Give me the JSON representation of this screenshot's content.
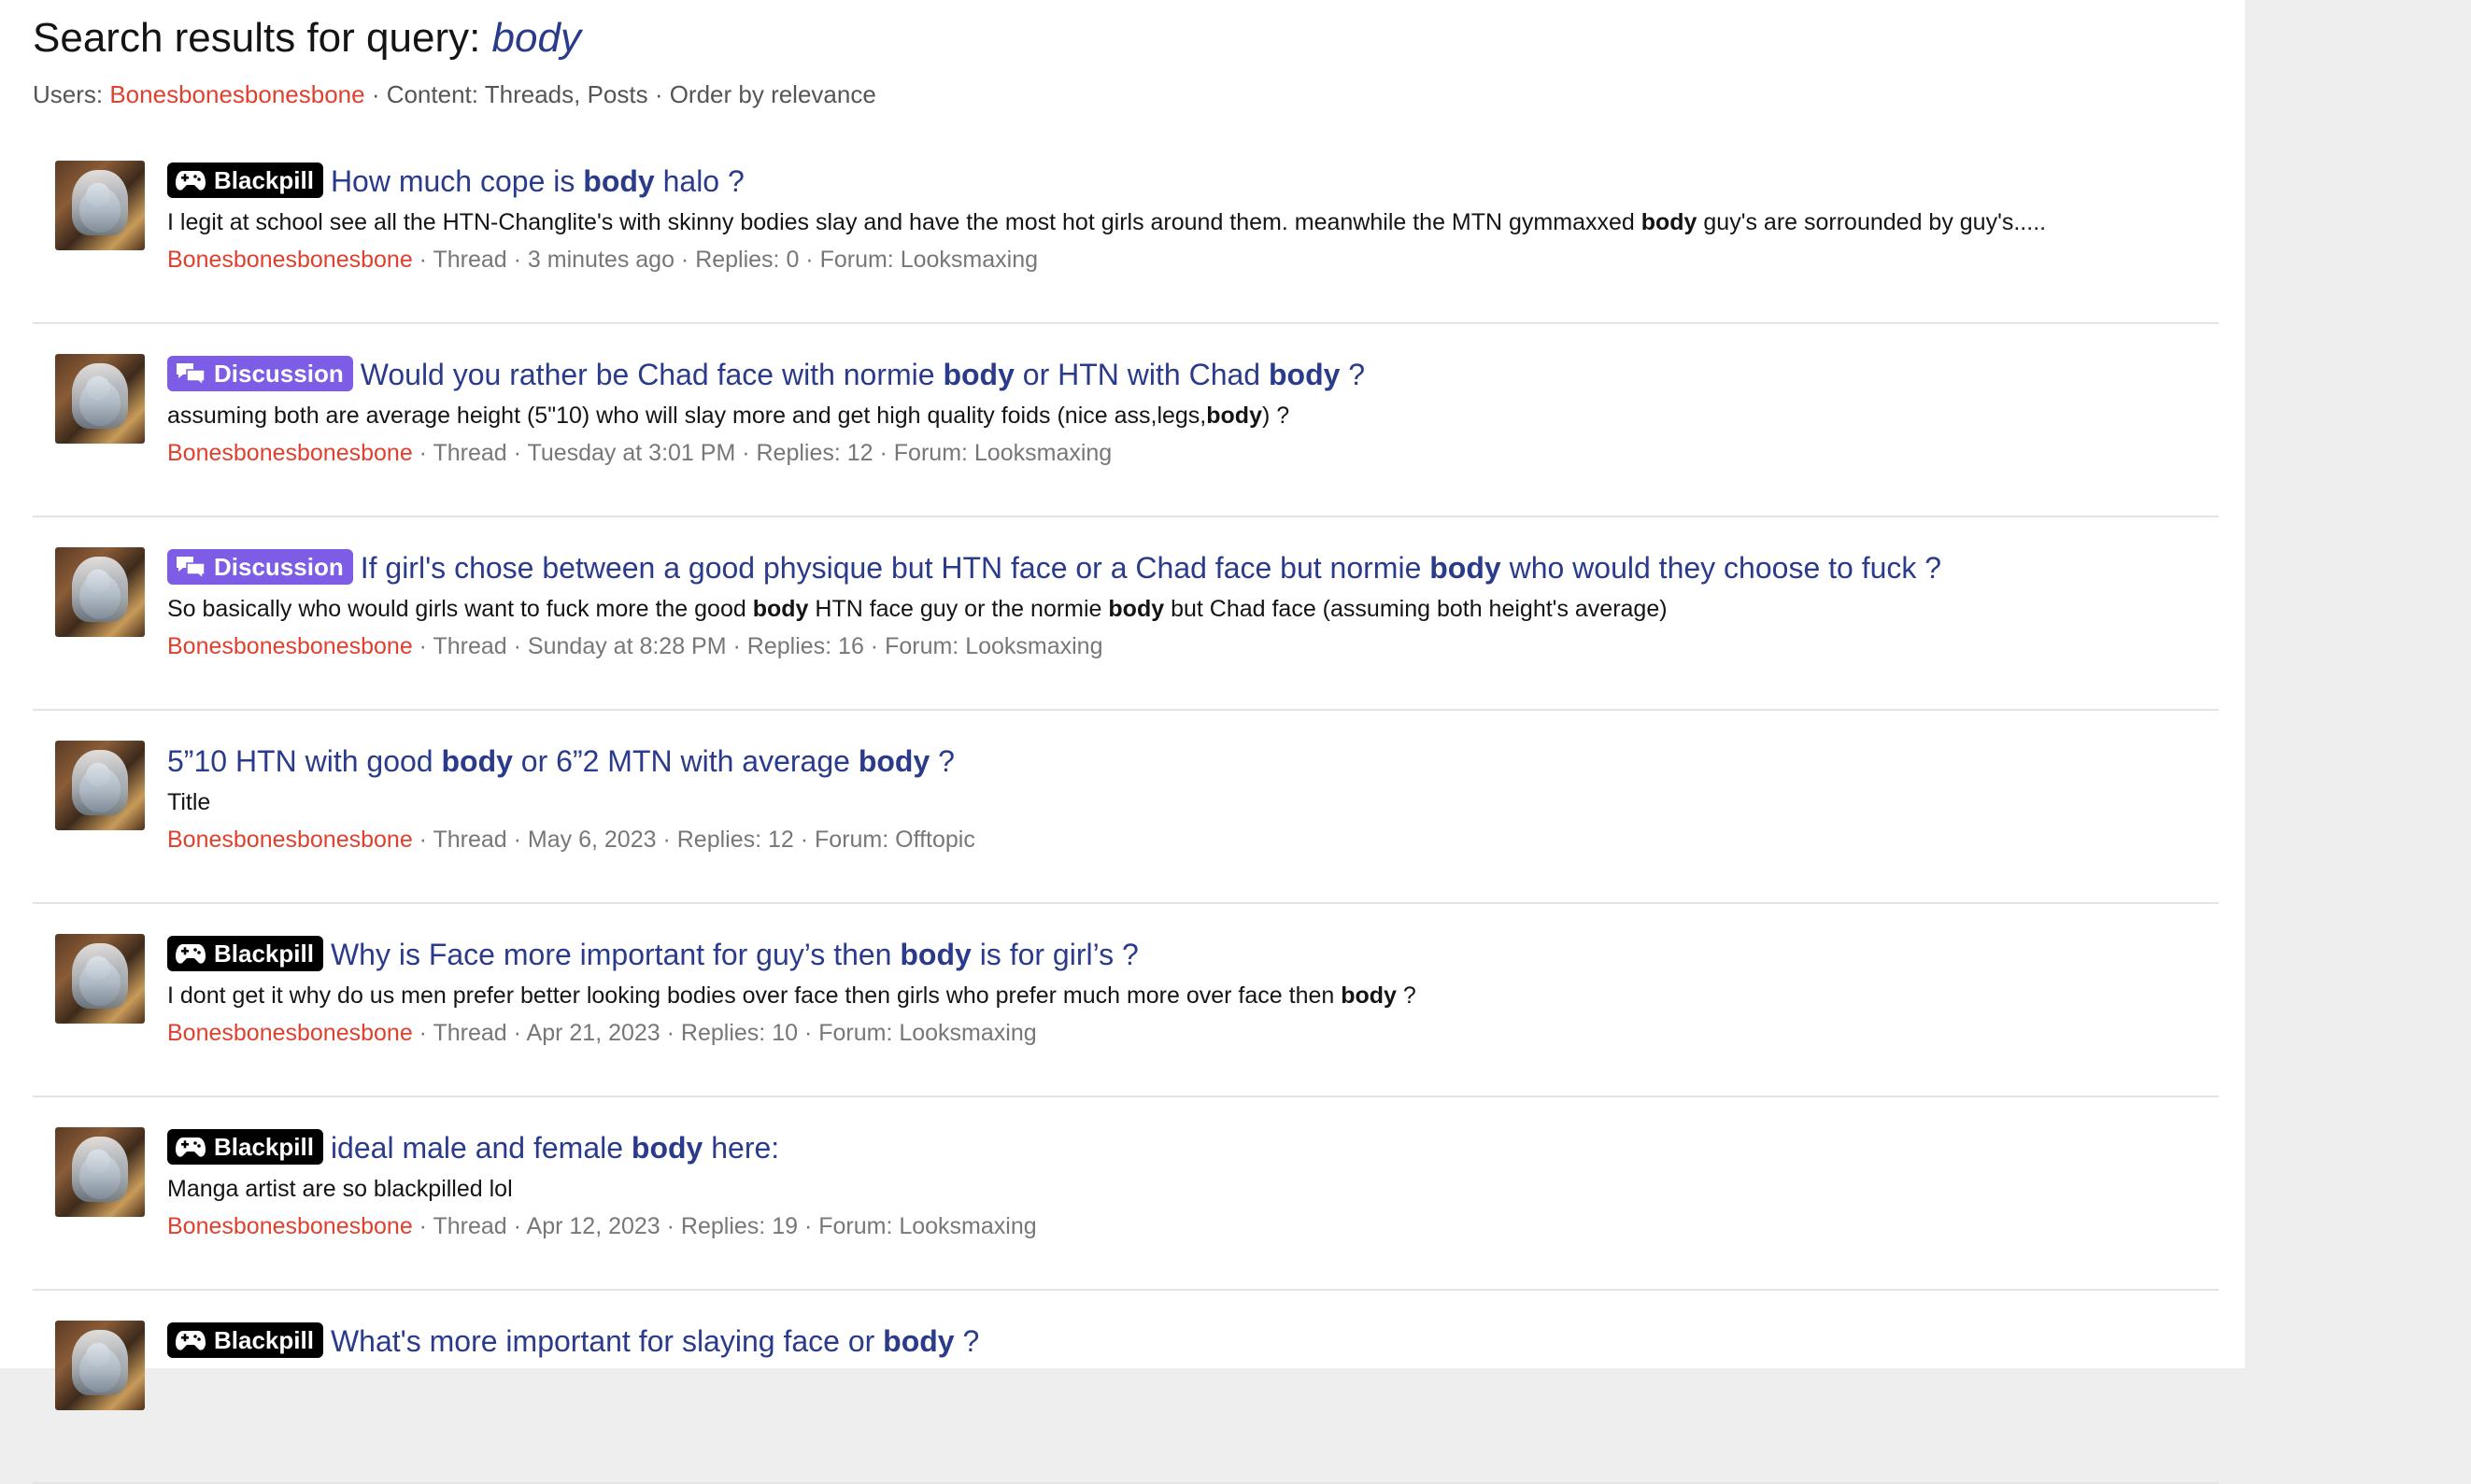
{
  "header": {
    "title_prefix": "Search results for query: ",
    "query": "body",
    "users_label": "Users: ",
    "user": "Bonesbonesbonesbone",
    "rest": " · Content: Threads, Posts · Order by relevance"
  },
  "results": [
    {
      "tag": "Blackpill",
      "tag_color": "#000000",
      "title": [
        [
          "How much cope is ",
          false
        ],
        [
          "body",
          true
        ],
        [
          " halo ?",
          false
        ]
      ],
      "snippet": [
        [
          "I legit at school see all the HTN-Changlite's with skinny bodies slay and have the most hot girls around them. meanwhile the MTN gymmaxxed ",
          false
        ],
        [
          "body",
          true
        ],
        [
          " guy's are sorrounded by guy's.....",
          false
        ]
      ],
      "author": "Bonesbonesbonesbone",
      "meta": " · Thread · 3 minutes ago · Replies: 0 · Forum: Looksmaxing"
    },
    {
      "tag": "Discussion",
      "tag_color": "#7d5ce6",
      "title": [
        [
          "Would you rather be Chad face with normie ",
          false
        ],
        [
          "body",
          true
        ],
        [
          " or HTN with Chad ",
          false
        ],
        [
          "body",
          true
        ],
        [
          " ?",
          false
        ]
      ],
      "snippet": [
        [
          "assuming both are average height (5\"10) who will slay more and get high quality foids (nice ass,legs,",
          false
        ],
        [
          "body",
          true
        ],
        [
          ") ?",
          false
        ]
      ],
      "author": "Bonesbonesbonesbone",
      "meta": " · Thread · Tuesday at 3:01 PM · Replies: 12 · Forum: Looksmaxing"
    },
    {
      "tag": "Discussion",
      "tag_color": "#7d5ce6",
      "title": [
        [
          "If girl's chose between a good physique but HTN face or a Chad face but normie ",
          false
        ],
        [
          "body",
          true
        ],
        [
          " who would they choose to fuck ?",
          false
        ]
      ],
      "snippet": [
        [
          "So basically who would girls want to fuck more the good ",
          false
        ],
        [
          "body",
          true
        ],
        [
          " HTN face guy or the normie ",
          false
        ],
        [
          "body",
          true
        ],
        [
          " but Chad face (assuming both height's average)",
          false
        ]
      ],
      "author": "Bonesbonesbonesbone",
      "meta": " · Thread · Sunday at 8:28 PM · Replies: 16 · Forum: Looksmaxing"
    },
    {
      "tag": "",
      "tag_color": "",
      "title": [
        [
          "5”10 HTN with good ",
          false
        ],
        [
          "body",
          true
        ],
        [
          " or 6”2 MTN with average ",
          false
        ],
        [
          "body",
          true
        ],
        [
          " ?",
          false
        ]
      ],
      "snippet": [
        [
          "Title",
          false
        ]
      ],
      "author": "Bonesbonesbonesbone",
      "meta": " · Thread · May 6, 2023 · Replies: 12 · Forum: Offtopic"
    },
    {
      "tag": "Blackpill",
      "tag_color": "#000000",
      "title": [
        [
          "Why is Face more important for guy’s then ",
          false
        ],
        [
          "body",
          true
        ],
        [
          " is for girl’s ?",
          false
        ]
      ],
      "snippet": [
        [
          "I dont get it why do us men prefer better looking bodies over face then girls who prefer much more over face then ",
          false
        ],
        [
          "body",
          true
        ],
        [
          " ?",
          false
        ]
      ],
      "author": "Bonesbonesbonesbone",
      "meta": " · Thread · Apr 21, 2023 · Replies: 10 · Forum: Looksmaxing"
    },
    {
      "tag": "Blackpill",
      "tag_color": "#000000",
      "title": [
        [
          "ideal male and female ",
          false
        ],
        [
          "body",
          true
        ],
        [
          " here:",
          false
        ]
      ],
      "snippet": [
        [
          "Manga artist are so blackpilled lol",
          false
        ]
      ],
      "author": "Bonesbonesbonesbone",
      "meta": " · Thread · Apr 12, 2023 · Replies: 19 · Forum: Looksmaxing"
    },
    {
      "tag": "Blackpill",
      "tag_color": "#000000",
      "title": [
        [
          "What's more important for slaying face or ",
          false
        ],
        [
          "body",
          true
        ],
        [
          " ?",
          false
        ]
      ],
      "snippet": [],
      "author": "",
      "meta": ""
    }
  ]
}
